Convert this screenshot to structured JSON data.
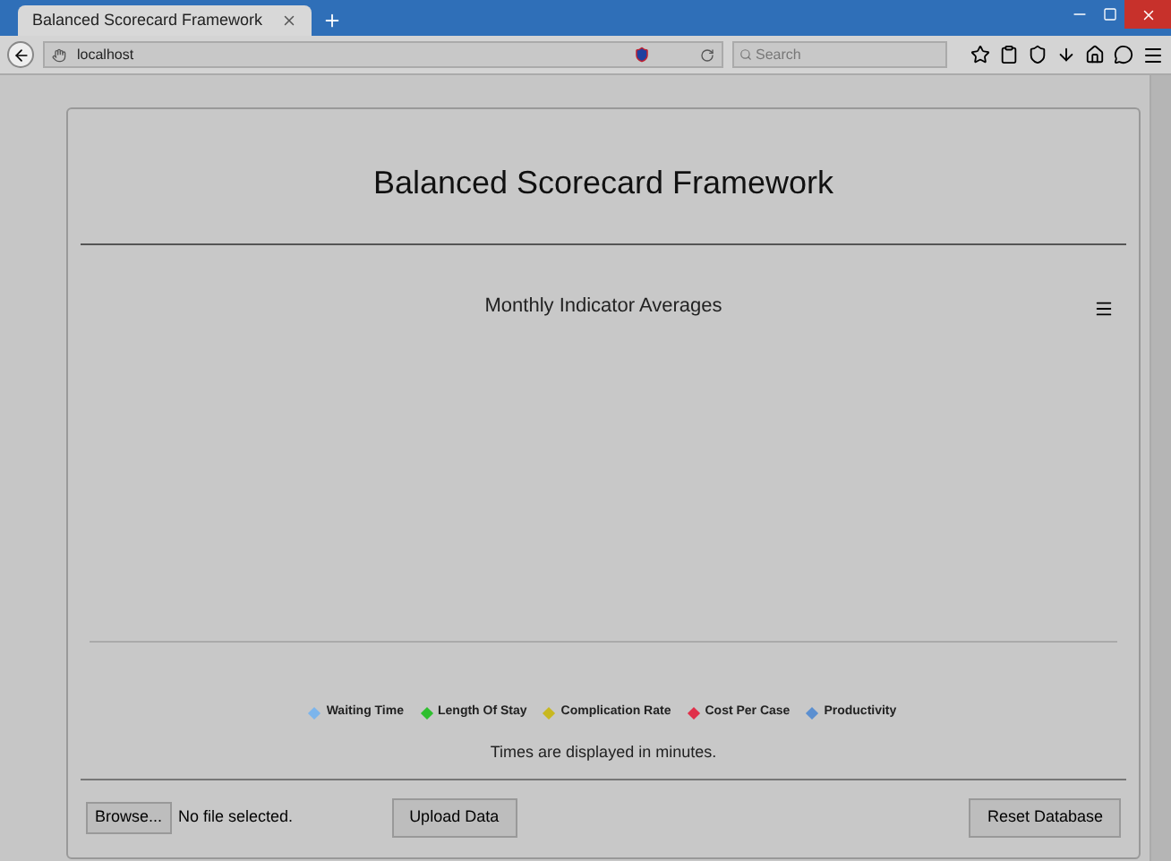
{
  "browser": {
    "tab_title": "Balanced Scorecard Framework",
    "address": "localhost",
    "search_placeholder": "Search"
  },
  "page": {
    "title": "Balanced Scorecard Framework",
    "chart": {
      "title": "Monthly Indicator Averages",
      "legend": [
        {
          "label": "Waiting Time",
          "color": "#7cb5ec"
        },
        {
          "label": "Length Of Stay",
          "color": "#2fbf2f"
        },
        {
          "label": "Complication Rate",
          "color": "#c8b820"
        },
        {
          "label": "Cost Per Case",
          "color": "#e0304a"
        },
        {
          "label": "Productivity",
          "color": "#5b8fd0"
        }
      ]
    },
    "note": "Times are displayed in minutes.",
    "browse_button": "Browse...",
    "file_status": "No file selected.",
    "upload_button": "Upload Data",
    "reset_button": "Reset Database"
  }
}
